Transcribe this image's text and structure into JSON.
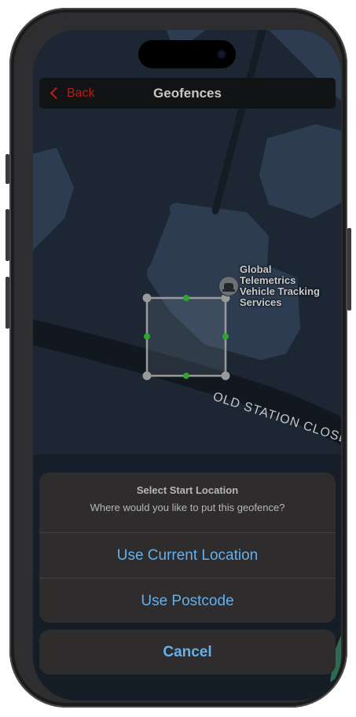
{
  "nav": {
    "back_label": "Back",
    "title": "Geofences"
  },
  "map": {
    "poi_name_lines": [
      "Global",
      "Telemetrics",
      "Vehicle Tracking",
      "Services"
    ],
    "poi_icon": "car-icon",
    "street_name": "OLD STATION CLOSE"
  },
  "geofence": {
    "shape": "square",
    "vertex_handle_color": "#9a9a9a",
    "midpoint_handle_color": "#2fa52f"
  },
  "action_sheet": {
    "title": "Select Start Location",
    "message": "Where would you like to put this geofence?",
    "actions": [
      "Use Current Location",
      "Use Postcode"
    ],
    "cancel_label": "Cancel"
  },
  "colors": {
    "accent_red": "#b71c1c",
    "action_blue": "#63b1ec",
    "map_background": "#1c2733"
  }
}
